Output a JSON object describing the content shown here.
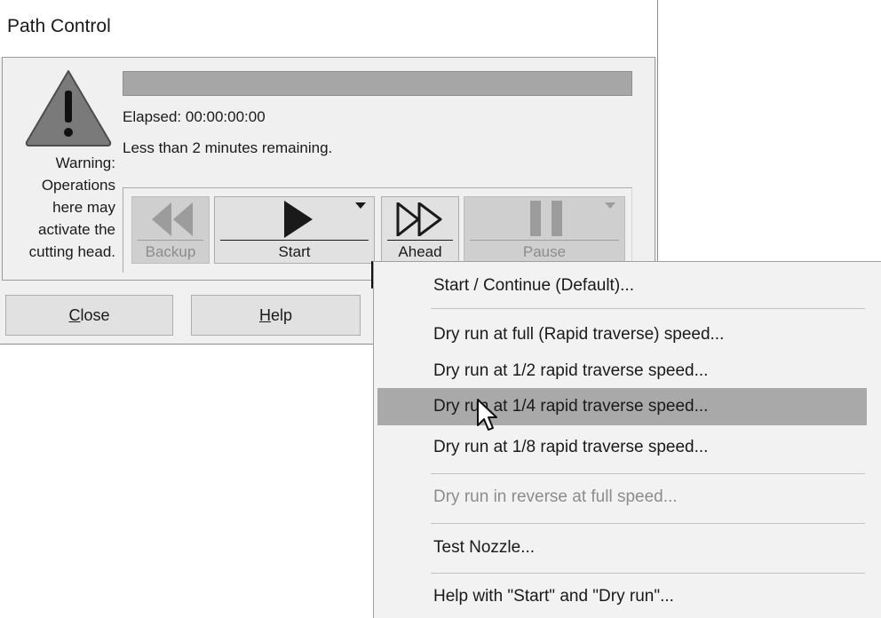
{
  "window": {
    "title": "Path Control"
  },
  "warning": {
    "icon": "warning-triangle-icon",
    "lines": [
      "Warning:",
      "Operations",
      "here may",
      "activate the",
      "cutting head."
    ]
  },
  "progress": {
    "fraction": 1.0,
    "color": "#a6a6a6"
  },
  "status": {
    "elapsed": "Elapsed: 00:00:00:00",
    "remaining": "Less than 2 minutes remaining."
  },
  "toolbar": {
    "backup_label": "Backup",
    "start_label": "Start",
    "ahead_label": "Ahead",
    "pause_label": "Pause"
  },
  "footer": {
    "close": {
      "mnemonic": "C",
      "rest": "lose"
    },
    "help": {
      "mnemonic": "H",
      "rest": "elp"
    }
  },
  "menu": {
    "items": [
      {
        "label": "Start / Continue (Default)...",
        "state": "normal"
      },
      {
        "label": "Dry run at full (Rapid traverse) speed...",
        "state": "normal"
      },
      {
        "label": "Dry run at 1/2 rapid traverse speed...",
        "state": "normal"
      },
      {
        "label": "Dry run at 1/4 rapid traverse speed...",
        "state": "highlighted"
      },
      {
        "label": "Dry run at 1/8 rapid traverse speed...",
        "state": "normal"
      },
      {
        "label": "Dry run in reverse at full speed...",
        "state": "disabled"
      },
      {
        "label": "Test Nozzle...",
        "state": "normal"
      },
      {
        "label": "Help with \"Start\" and \"Dry run\"...",
        "state": "normal"
      }
    ]
  },
  "colors": {
    "highlight": "#a9a9a9",
    "disabled_text": "#8c8c8c",
    "dialog_bg": "#f0f0f0"
  }
}
